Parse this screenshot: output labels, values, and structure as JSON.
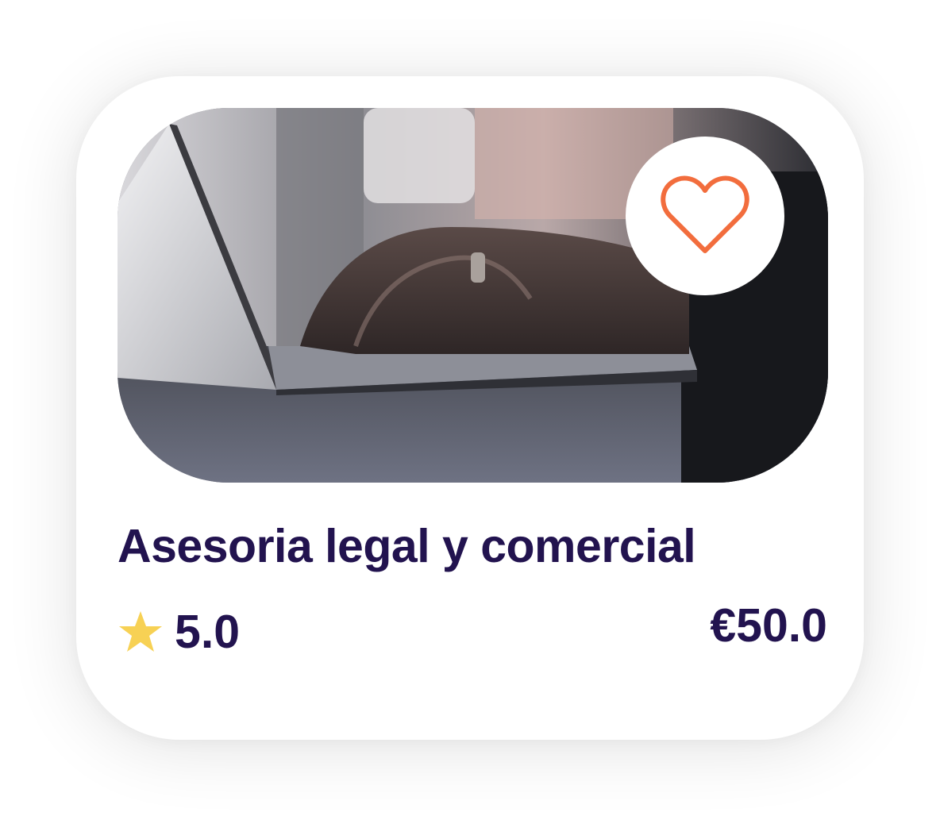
{
  "card": {
    "title": "Asesoria legal y comercial",
    "rating": "5.0",
    "price": "€50.0",
    "image_subject": "hands typing on a laptop",
    "favorite_icon": "heart-outline-icon",
    "rating_icon": "star-icon"
  },
  "colors": {
    "text": "#22134f",
    "heart": "#f26d3d",
    "star": "#f7d154",
    "card_bg": "#ffffff"
  }
}
